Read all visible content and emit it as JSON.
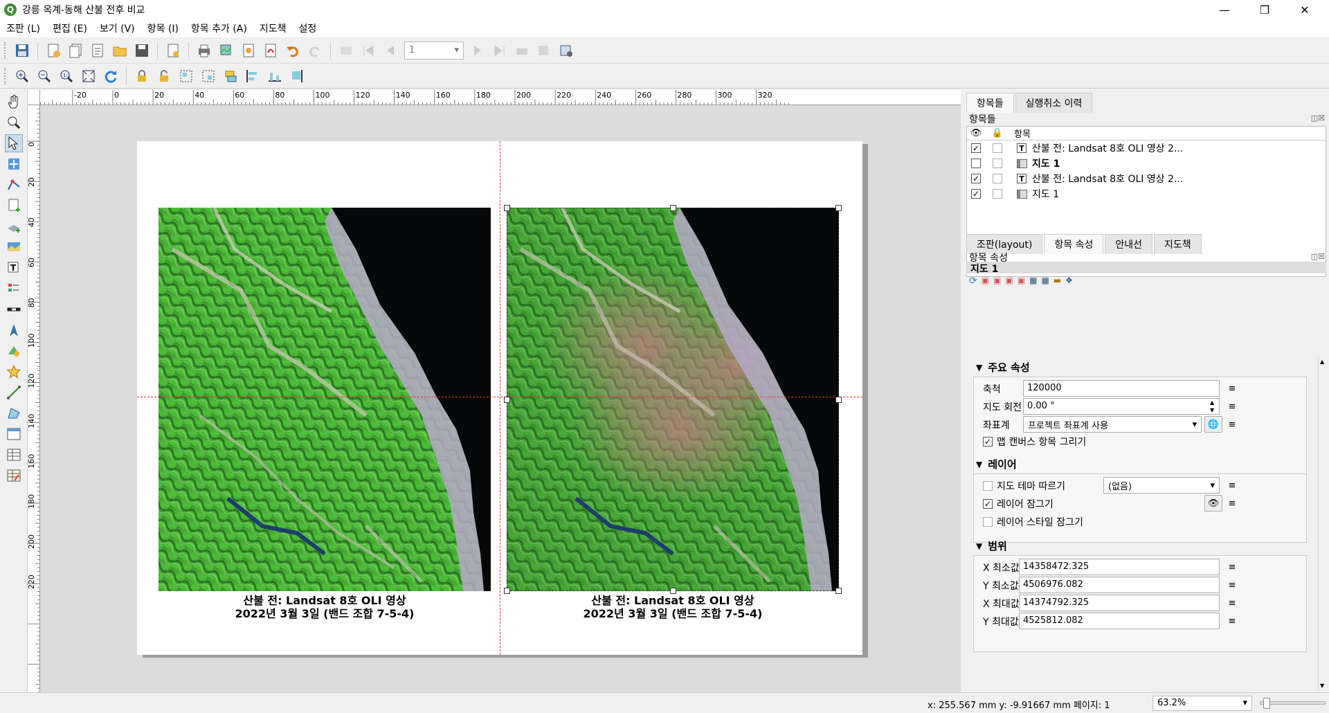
{
  "window": {
    "title": "강릉 옥계-동해 산불 전후 비교",
    "logo_letter": "Q"
  },
  "menu": [
    "조판 (L)",
    "편집 (E)",
    "보기 (V)",
    "항목 (I)",
    "항목 추가 (A)",
    "지도책",
    "설정"
  ],
  "toolbar": {
    "page_value": "1"
  },
  "hruler_labels": [
    "-20",
    "0",
    "20",
    "40",
    "60",
    "80",
    "100",
    "120",
    "140",
    "160",
    "180",
    "200",
    "220",
    "240",
    "260",
    "280",
    "300",
    "320"
  ],
  "vruler_labels": [
    "0",
    "20",
    "40",
    "60",
    "80",
    "100",
    "120",
    "140",
    "160",
    "180",
    "200",
    "220"
  ],
  "layout": {
    "left_caption_line1": "산불 전: Landsat 8호 OLI 영상",
    "left_caption_line2": "2022년 3월 3일 (밴드 조합 7-5-4)",
    "right_caption_line1": "산불 전: Landsat 8호 OLI 영상",
    "right_caption_line2": "2022년 3월 3일 (밴드 조합 7-5-4)"
  },
  "status": {
    "coords": "x: 255.567 mm  y: -9.91667 mm  페이지: 1",
    "zoom": "63.2%",
    "zoom_fraction": 0.05
  },
  "panel_top": {
    "tabs": [
      "항목들",
      "실행취소 이력"
    ],
    "dock_title": "항목들",
    "header_label": "항목",
    "items": [
      {
        "label": "산불 전: Landsat 8호 OLI 영상 2...",
        "type": "text",
        "visible": true,
        "locked": false,
        "bold": false
      },
      {
        "label": "지도 1",
        "type": "map",
        "visible": false,
        "locked": false,
        "bold": true
      },
      {
        "label": "산불 전: Landsat 8호 OLI 영상 2...",
        "type": "text",
        "visible": true,
        "locked": false,
        "bold": false
      },
      {
        "label": "지도 1",
        "type": "map",
        "visible": true,
        "locked": false,
        "bold": false
      }
    ]
  },
  "panel_bottom": {
    "tabs": [
      "조판(layout)",
      "항목 속성",
      "안내선",
      "지도책"
    ],
    "dock_title": "항목 속성",
    "item_name": "지도 1",
    "main_group": "주요 속성",
    "scale_label": "축척",
    "scale_value": "120000",
    "rotation_label": "지도 회전",
    "rotation_value": "0.00 °",
    "crs_label": "좌표계",
    "crs_value": "프로젝트 좌표계 사용",
    "draw_canvas_label": "맵 캔버스 항목 그리기",
    "layer_group": "레이어",
    "follow_theme_label": "지도 테마 따르기",
    "follow_theme_value": "(없음)",
    "lock_layers_label": "레이어 잠그기",
    "lock_styles_label": "레이어 스타일 잠그기",
    "extent_group": "범위",
    "xmin_label": "X 최소값",
    "xmin_value": "14358472.325",
    "ymin_label": "Y 최소값",
    "ymin_value": "4506976.082",
    "xmax_label": "X 최대값",
    "xmax_value": "14374792.325",
    "ymax_label": "Y 최대값",
    "ymax_value": "4525812.082"
  },
  "colors": {
    "vegetation": "#3fae3a",
    "burn": "#c77a86",
    "sea": "#050808",
    "guide": "#e33333"
  }
}
